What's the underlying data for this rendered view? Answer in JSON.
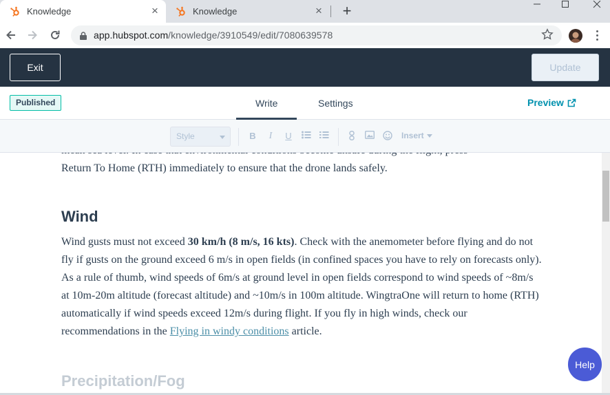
{
  "browser": {
    "tabs": [
      {
        "title": "Knowledge",
        "active": true
      },
      {
        "title": "Knowledge",
        "active": false
      }
    ],
    "new_tab_glyph": "+",
    "close_glyph": "×",
    "url_host": "app.hubspot.com",
    "url_path": "/knowledge/3910549/edit/7080639578"
  },
  "header": {
    "exit_label": "Exit",
    "update_label": "Update"
  },
  "subheader": {
    "status_badge": "Published",
    "tab_write": "Write",
    "tab_settings": "Settings",
    "preview_label": "Preview"
  },
  "editor_toolbar": {
    "style_placeholder": "Style",
    "bold": "B",
    "italic": "I",
    "underline": "U",
    "insert_label": "Insert"
  },
  "article": {
    "cut_top_line": "mean sea level. In case that environmental conditions become unsafe during the flight, press",
    "intro_tail": "Return To Home (RTH) immediately to ensure that the drone lands safely.",
    "wind_heading": "Wind",
    "wind_p_start": "Wind gusts must not exceed ",
    "wind_p_bold": "30 km/h (8 m/s, 16 kts)",
    "wind_p_mid": ". Check with the anemometer before flying and do not fly if gusts on the ground exceed 6 m/s in open fields (in confined spaces you have to rely on forecasts only). As a rule of thumb, wind speeds of 6m/s at ground level in open fields correspond to wind speeds of ~8m/s at 10m-20m altitude (forecast altitude) and ~10m/s in 100m altitude. WingtraOne will return to home (RTH) automatically if wind speeds exceed 12m/s during flight. If you fly in high winds, check our recommendations in the ",
    "wind_p_link": "Flying in windy conditions",
    "wind_p_end": " article.",
    "next_heading": "Precipitation/Fog"
  },
  "help_label": "Help",
  "colors": {
    "header_bg": "#253342",
    "badge_border": "#00bda5",
    "preview_link": "#0091ae",
    "help_bg": "#4b5bd6",
    "link": "#4c8fa8"
  }
}
